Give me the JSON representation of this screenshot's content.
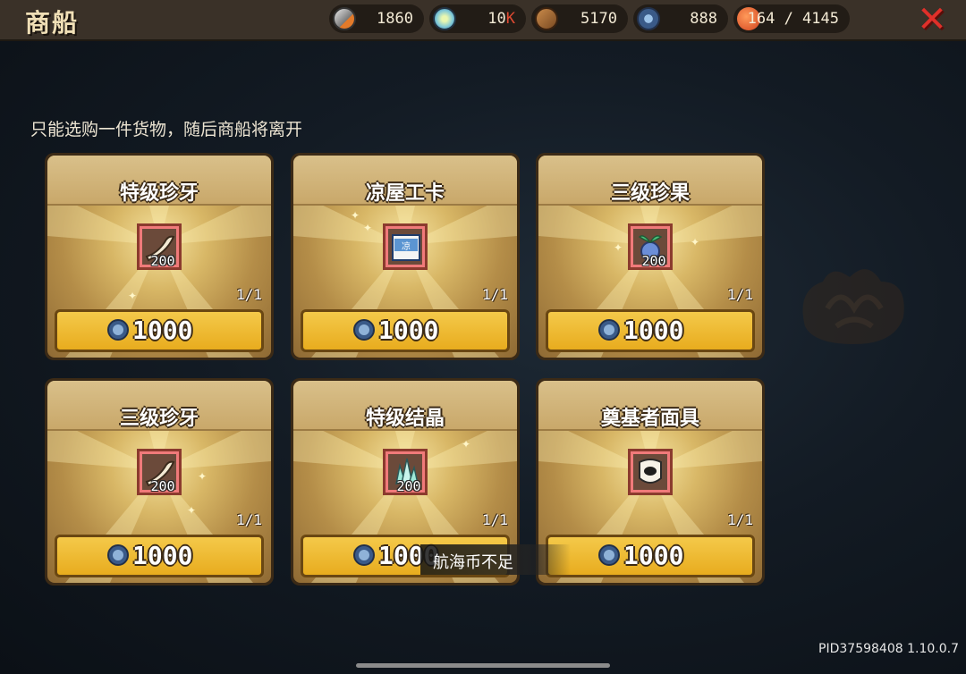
{
  "header": {
    "title": "商船",
    "close_label": "✕",
    "resources": [
      {
        "icon": "iron-ore-icon",
        "value": "1860"
      },
      {
        "icon": "crystal-disc-icon",
        "value": "10",
        "suffix": "K"
      },
      {
        "icon": "wood-log-icon",
        "value": "5170"
      },
      {
        "icon": "sea-coin-icon",
        "value": "888"
      },
      {
        "icon": "shrimp-food-icon",
        "value": "164 / 4145"
      }
    ]
  },
  "notice": "只能选购一件货物，随后商船将离开",
  "cards": [
    {
      "title": "特级珍牙",
      "icon": "horn-tusk-icon",
      "qty": "200",
      "stock": "1/1",
      "price": "1000"
    },
    {
      "title": "凉屋工卡",
      "icon": "id-card-icon",
      "qty": "",
      "stock": "1/1",
      "price": "1000"
    },
    {
      "title": "三级珍果",
      "icon": "fruit-icon",
      "qty": "200",
      "stock": "1/1",
      "price": "1000"
    },
    {
      "title": "三级珍牙",
      "icon": "horn-tusk-icon",
      "qty": "200",
      "stock": "1/1",
      "price": "1000"
    },
    {
      "title": "特级结晶",
      "icon": "crystal-cluster-icon",
      "qty": "200",
      "stock": "1/1",
      "price": "1000"
    },
    {
      "title": "奠基者面具",
      "icon": "mask-icon",
      "qty": "",
      "stock": "1/1",
      "price": "1000"
    }
  ],
  "id_card_text": "凉",
  "toast": "航海币不足",
  "footer": {
    "pid": "PID37598408 1.10.0.7"
  },
  "colors": {
    "gold": "#e8ac1e",
    "close_red": "#e0302a",
    "card_frame": "#3b2a16"
  }
}
